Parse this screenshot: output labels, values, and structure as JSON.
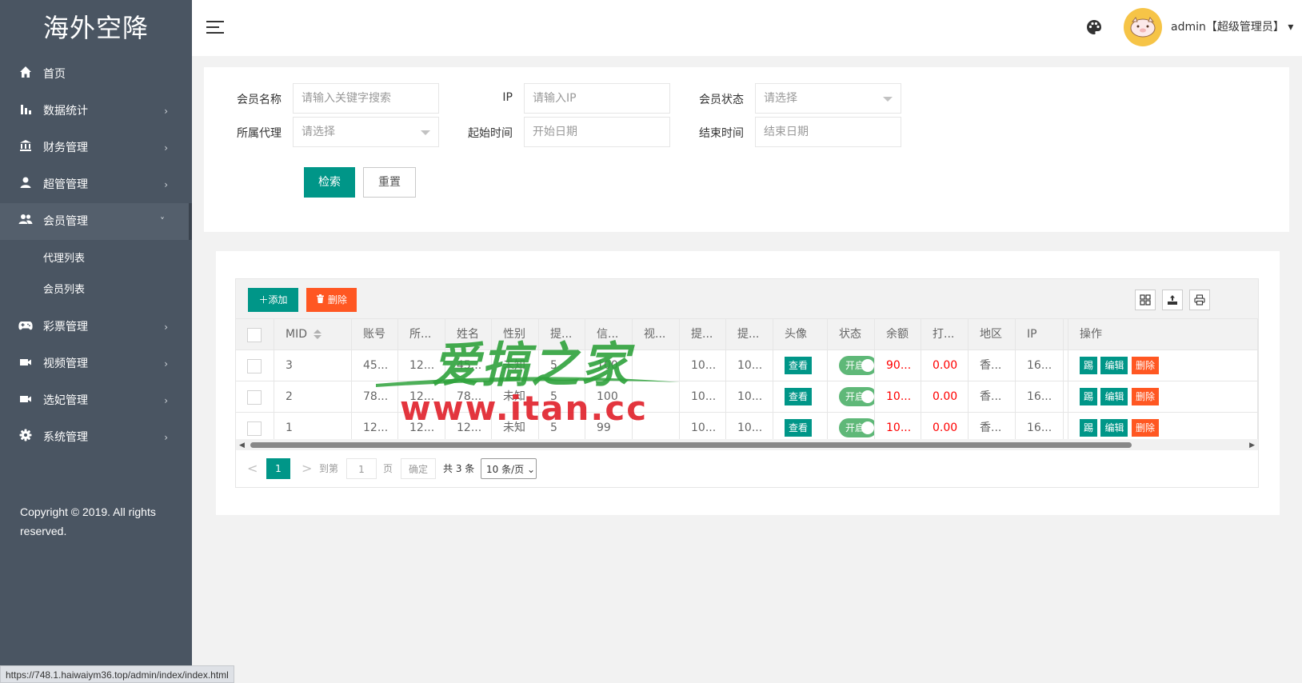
{
  "app": {
    "title": "海外空降"
  },
  "sidebar": {
    "items": [
      {
        "label": "首页",
        "icon": "home-icon",
        "has_arrow": false
      },
      {
        "label": "数据统计",
        "icon": "bar-chart-icon",
        "has_arrow": true
      },
      {
        "label": "财务管理",
        "icon": "bank-icon",
        "has_arrow": true
      },
      {
        "label": "超管管理",
        "icon": "user-icon",
        "has_arrow": true
      },
      {
        "label": "会员管理",
        "icon": "users-icon",
        "has_arrow": true,
        "expanded": true
      },
      {
        "label": "彩票管理",
        "icon": "gamepad-icon",
        "has_arrow": true
      },
      {
        "label": "视频管理",
        "icon": "video-icon",
        "has_arrow": true
      },
      {
        "label": "选妃管理",
        "icon": "video-icon",
        "has_arrow": true
      },
      {
        "label": "系统管理",
        "icon": "gear-icon",
        "has_arrow": true
      }
    ],
    "sub_items": [
      "代理列表",
      "会员列表"
    ],
    "copyright": "Copyright © 2019. All rights reserved."
  },
  "header": {
    "user_label": "admin【超级管理员】",
    "caret": "▾"
  },
  "search": {
    "member_name": {
      "label": "会员名称",
      "placeholder": "请输入关键字搜索"
    },
    "ip": {
      "label": "IP",
      "placeholder": "请输入IP"
    },
    "member_status": {
      "label": "会员状态",
      "placeholder": "请选择"
    },
    "agent": {
      "label": "所属代理",
      "placeholder": "请选择"
    },
    "start_time": {
      "label": "起始时间",
      "placeholder": "开始日期"
    },
    "end_time": {
      "label": "结束时间",
      "placeholder": "结束日期"
    },
    "search_btn": "检索",
    "reset_btn": "重置"
  },
  "toolbar": {
    "add_label": "添加",
    "delete_label": "删除"
  },
  "table": {
    "headers": [
      "MID",
      "账号",
      "所...",
      "姓名",
      "性别",
      "提...",
      "信...",
      "视...",
      "提...",
      "提...",
      "头像",
      "状态",
      "余额",
      "打...",
      "地区",
      "IP",
      "操作"
    ],
    "rows": [
      {
        "mid": "3",
        "account": "45...",
        "agent": "12...",
        "name": "45...",
        "gender": "未知",
        "c6": "5",
        "credit": "100",
        "c8": "",
        "c9": "10...",
        "c10": "10...",
        "avatar_btn": "查看",
        "status": "开启",
        "balance": "90...",
        "c14": "0.00",
        "region": "香...",
        "ip": "16..."
      },
      {
        "mid": "2",
        "account": "78...",
        "agent": "12...",
        "name": "78...",
        "gender": "未知",
        "c6": "5",
        "credit": "100",
        "c8": "",
        "c9": "10...",
        "c10": "10...",
        "avatar_btn": "查看",
        "status": "开启",
        "balance": "10...",
        "c14": "0.00",
        "region": "香...",
        "ip": "16..."
      },
      {
        "mid": "1",
        "account": "12...",
        "agent": "12...",
        "name": "12...",
        "gender": "未知",
        "c6": "5",
        "credit": "99",
        "c8": "",
        "c9": "10...",
        "c10": "10...",
        "avatar_btn": "查看",
        "status": "开启",
        "balance": "10...",
        "c14": "0.00",
        "region": "香...",
        "ip": "16..."
      }
    ],
    "actions": [
      "踢",
      "编辑",
      "删除"
    ]
  },
  "pagination": {
    "prev": "<",
    "current": "1",
    "next": ">",
    "goto_label": "到第",
    "goto_value": "1",
    "page_label": "页",
    "confirm": "确定",
    "total": "共 3 条",
    "page_size": "10 条/页"
  },
  "watermark": {
    "cn": "爱搞之家",
    "en": "www.itan.cc"
  },
  "status_url": "https://748.1.haiwaiym36.top/admin/index/index.html",
  "colors": {
    "sidebar": "#4a5562",
    "primary": "#009688",
    "danger": "#ff5722",
    "switch": "#5fb878",
    "money": "#ff0000"
  }
}
